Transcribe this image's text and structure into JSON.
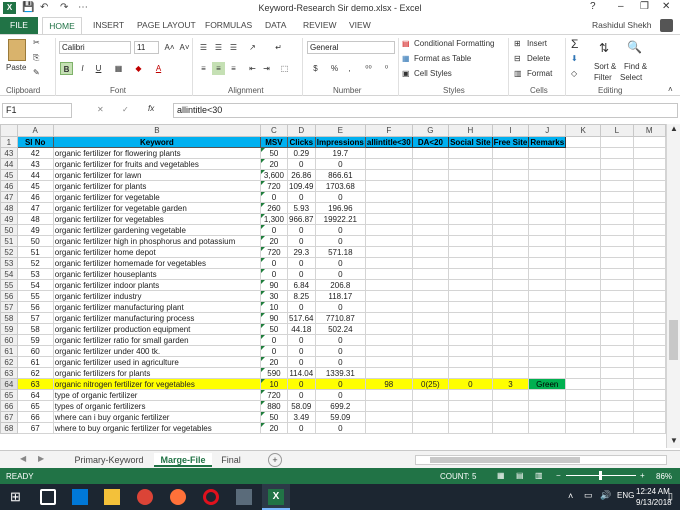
{
  "window": {
    "title": "Keyword-Research Sir demo.xlsx - Excel",
    "app_icon_label": "X",
    "user": "Rashidul Shekh",
    "help_label": "?",
    "min_label": "–",
    "restore_label": "❐",
    "close_label": "✕"
  },
  "quick_access": {
    "save": "💾",
    "undo": "↶",
    "redo": "↷",
    "more": "⋯"
  },
  "ribbon_tabs": [
    "FILE",
    "HOME",
    "INSERT",
    "PAGE LAYOUT",
    "FORMULAS",
    "DATA",
    "REVIEW",
    "VIEW"
  ],
  "ribbon": {
    "clipboard": {
      "label": "Clipboard",
      "paste": "Paste"
    },
    "font": {
      "label": "Font",
      "name": "Calibri",
      "size": "11",
      "bold": "B",
      "italic": "I",
      "underline": "U",
      "grow": "A˄",
      "shrink": "A˅",
      "color": "A"
    },
    "alignment": {
      "label": "Alignment"
    },
    "number": {
      "label": "Number",
      "format": "General",
      "currency": "$",
      "percent": "%",
      "comma": ","
    },
    "styles": {
      "label": "Styles",
      "cond": "Conditional Formatting",
      "table": "Format as Table",
      "cell": "Cell Styles"
    },
    "cells": {
      "label": "Cells",
      "insert": "Insert",
      "delete": "Delete",
      "format": "Format"
    },
    "editing": {
      "label": "Editing",
      "sum": "Σ",
      "sort": "Sort &",
      "filter": "Filter",
      "find": "Find &",
      "select": "Select"
    }
  },
  "formula_bar": {
    "name_box": "F1",
    "fx": "fx",
    "cancel": "✕",
    "enter": "✓",
    "formula": "allintitle<30"
  },
  "columns": [
    "A",
    "B",
    "C",
    "D",
    "E",
    "F",
    "G",
    "H",
    "I",
    "J",
    "K",
    "L",
    "M"
  ],
  "header_row": {
    "row_num": "1",
    "cells": [
      "Sl No",
      "Keyword",
      "MSV",
      "Clicks",
      "Impressions",
      "allintitle<30",
      "DA<20",
      "Social Site",
      "Free Site",
      "Remarks"
    ]
  },
  "rows": [
    {
      "r": "43",
      "a": "42",
      "b": "organic fertilizer for flowering plants",
      "c": "50",
      "d": "0.29",
      "e": "19.7"
    },
    {
      "r": "44",
      "a": "43",
      "b": "organic fertilizer for fruits and vegetables",
      "c": "20",
      "d": "0",
      "e": "0"
    },
    {
      "r": "45",
      "a": "44",
      "b": "organic fertilizer for lawn",
      "c": "3,600",
      "d": "26.86",
      "e": "866.61"
    },
    {
      "r": "46",
      "a": "45",
      "b": "organic fertilizer for plants",
      "c": "720",
      "d": "109.49",
      "e": "1703.68"
    },
    {
      "r": "47",
      "a": "46",
      "b": "organic fertilizer for vegetable",
      "c": "0",
      "d": "0",
      "e": "0"
    },
    {
      "r": "48",
      "a": "47",
      "b": "organic fertilizer for vegetable garden",
      "c": "260",
      "d": "5.93",
      "e": "196.96"
    },
    {
      "r": "49",
      "a": "48",
      "b": "organic fertilizer for vegetables",
      "c": "1,300",
      "d": "966.87",
      "e": "19922.21"
    },
    {
      "r": "50",
      "a": "49",
      "b": "organic fertilizer gardening vegetable",
      "c": "0",
      "d": "0",
      "e": "0"
    },
    {
      "r": "51",
      "a": "50",
      "b": "organic fertilizer high in phosphorus and potassium",
      "c": "20",
      "d": "0",
      "e": "0"
    },
    {
      "r": "52",
      "a": "51",
      "b": "organic fertilizer home depot",
      "c": "720",
      "d": "29.3",
      "e": "571.18"
    },
    {
      "r": "53",
      "a": "52",
      "b": "organic fertilizer homemade for vegetables",
      "c": "0",
      "d": "0",
      "e": "0"
    },
    {
      "r": "54",
      "a": "53",
      "b": "organic fertilizer houseplants",
      "c": "0",
      "d": "0",
      "e": "0"
    },
    {
      "r": "55",
      "a": "54",
      "b": "organic fertilizer indoor plants",
      "c": "90",
      "d": "6.84",
      "e": "206.8"
    },
    {
      "r": "56",
      "a": "55",
      "b": "organic fertilizer industry",
      "c": "30",
      "d": "8.25",
      "e": "118.17"
    },
    {
      "r": "57",
      "a": "56",
      "b": "organic fertilizer manufacturing plant",
      "c": "10",
      "d": "0",
      "e": "0"
    },
    {
      "r": "58",
      "a": "57",
      "b": "organic fertilizer manufacturing process",
      "c": "90",
      "d": "517.64",
      "e": "7710.87"
    },
    {
      "r": "59",
      "a": "58",
      "b": "organic fertilizer production equipment",
      "c": "50",
      "d": "44.18",
      "e": "502.24"
    },
    {
      "r": "60",
      "a": "59",
      "b": "organic fertilizer ratio for small garden",
      "c": "0",
      "d": "0",
      "e": "0"
    },
    {
      "r": "61",
      "a": "60",
      "b": "organic fertilizer under 400 tk.",
      "c": "0",
      "d": "0",
      "e": "0"
    },
    {
      "r": "62",
      "a": "61",
      "b": "organic fertilizer used in agriculture",
      "c": "20",
      "d": "0",
      "e": "0"
    },
    {
      "r": "63",
      "a": "62",
      "b": "organic fertilizers for plants",
      "c": "590",
      "d": "114.04",
      "e": "1339.31"
    },
    {
      "r": "64",
      "a": "63",
      "b": "organic nitrogen fertilizer for vegetables",
      "c": "10",
      "d": "0",
      "e": "0",
      "f": "98",
      "g": "0(25)",
      "h": "0",
      "i": "3",
      "j": "Green"
    },
    {
      "r": "65",
      "a": "64",
      "b": "type of organic fertilizer",
      "c": "720",
      "d": "0",
      "e": "0"
    },
    {
      "r": "66",
      "a": "65",
      "b": "types of organic fertilizers",
      "c": "880",
      "d": "58.09",
      "e": "699.2"
    },
    {
      "r": "67",
      "a": "66",
      "b": "where can i buy organic fertilizer",
      "c": "50",
      "d": "3.49",
      "e": "59.09"
    },
    {
      "r": "68",
      "a": "67",
      "b": "where to buy organic fertilizer for vegetables",
      "c": "20",
      "d": "0",
      "e": "0"
    }
  ],
  "sheets": [
    "Primary-Keyword",
    "Marge-File",
    "Final"
  ],
  "sheet_add": "+",
  "status": {
    "mode": "READY",
    "count": "COUNT: 5",
    "zoom": "86%"
  },
  "taskbar": {
    "time": "12:24 AM",
    "date": "9/13/2018",
    "lang": "ENG"
  },
  "colors": {
    "excel_green": "#217346",
    "header_blue": "#00b0f0",
    "highlight_yellow": "#ffff00",
    "remark_green": "#00b050"
  }
}
